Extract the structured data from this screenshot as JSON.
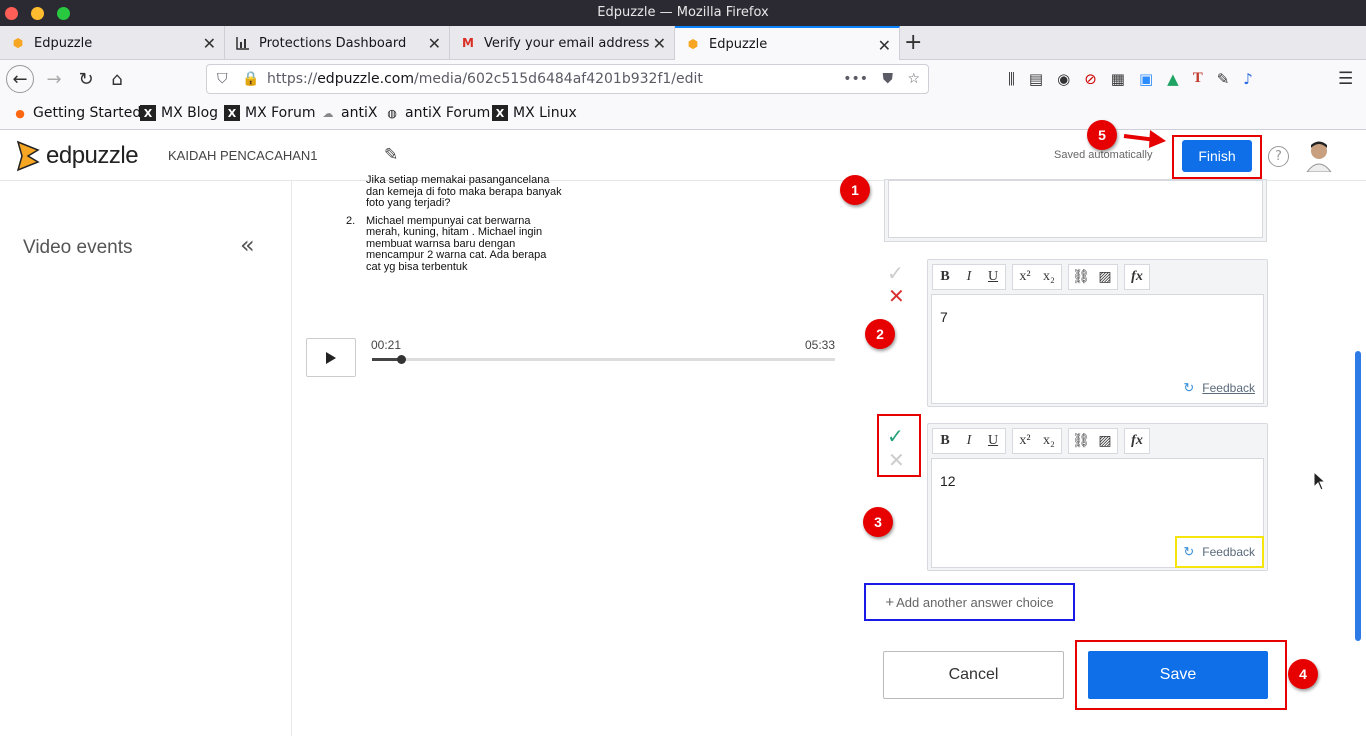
{
  "window": {
    "title": "Edpuzzle — Mozilla Firefox"
  },
  "tabs": [
    {
      "label": "Edpuzzle",
      "icon": "edpuzzle-icon"
    },
    {
      "label": "Protections Dashboard",
      "icon": "chart-icon"
    },
    {
      "label": "Verify your email address",
      "icon": "gmail-icon"
    },
    {
      "label": "Edpuzzle",
      "icon": "edpuzzle-icon",
      "active": true
    }
  ],
  "url": {
    "prefix": "https://",
    "host": "edpuzzle.com",
    "path": "/media/602c515d6484af4201b932f1/edit"
  },
  "bookmarks": [
    {
      "label": "Getting Started"
    },
    {
      "label": "MX Blog"
    },
    {
      "label": "MX Forum"
    },
    {
      "label": "antiX"
    },
    {
      "label": "antiX Forum"
    },
    {
      "label": "MX Linux"
    }
  ],
  "app": {
    "logo": "edpuzzle",
    "video_title": "KAIDAH PENCACAHAN1",
    "saved_status": "Saved automatically",
    "finish_label": "Finish"
  },
  "sidebar": {
    "title": "Video events",
    "collapse_glyph": "«"
  },
  "video": {
    "slide_text": {
      "line0": "Jika setiap memakai pasangancelana",
      "line1": "dan kemeja di foto maka berapa banyak",
      "line2": "foto yang terjadi?",
      "item_no": "2.",
      "q2_l1": "Michael mempunyai cat berwarna",
      "q2_l2": "merah, kuning, hitam . Michael ingin",
      "q2_l3": "membuat warnsa baru dengan",
      "q2_l4": "mencampur 2 warna cat. Ada berapa",
      "q2_l5": "cat yg bisa terbentuk"
    },
    "current_time": "00:21",
    "duration": "05:33",
    "progress": 0.063
  },
  "answers": [
    {
      "text": "7",
      "correct": false,
      "feedback_label": "Feedback"
    },
    {
      "text": "12",
      "correct": true,
      "feedback_label": "Feedback"
    }
  ],
  "add_choice_label": "Add another answer choice",
  "cancel_label": "Cancel",
  "save_label": "Save",
  "annotations": {
    "n1": "1",
    "n2": "2",
    "n3": "3",
    "n4": "4",
    "n5": "5"
  },
  "colors": {
    "brand_blue": "#0e6fe8",
    "highlight_red": "#e60000",
    "highlight_blue": "#1a1ae6",
    "highlight_yellow": "#f5e50a",
    "correct_green": "#25a07a",
    "wrong_red": "#d93030"
  }
}
